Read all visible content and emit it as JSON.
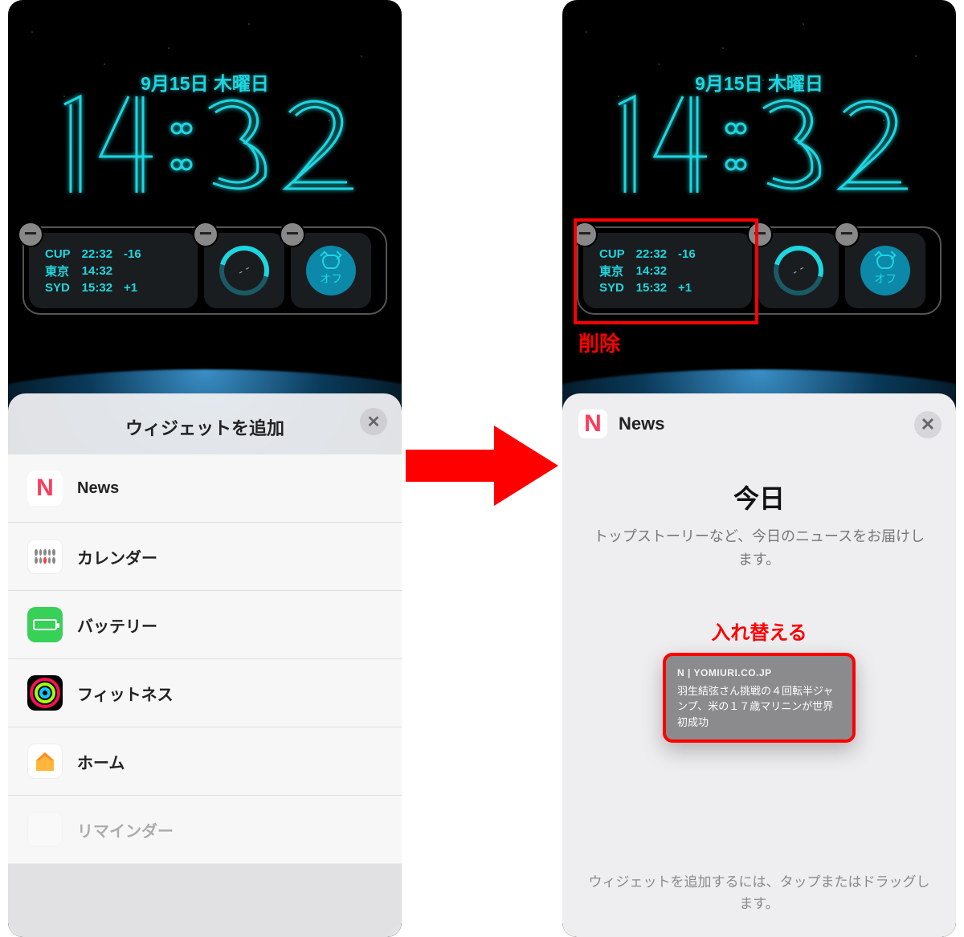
{
  "lockscreen": {
    "date": "9月15日 木曜日",
    "time": "14:32",
    "worldclock": [
      {
        "city": "CUP",
        "time": "22:32",
        "offset": "-16"
      },
      {
        "city": "東京",
        "time": "14:32",
        "offset": ""
      },
      {
        "city": "SYD",
        "time": "15:32",
        "offset": "+1"
      }
    ],
    "ring_value": "- -",
    "alarm_label": "オフ"
  },
  "annotations": {
    "delete_label": "削除",
    "replace_label": "入れ替える"
  },
  "gallery": {
    "title": "ウィジェットを追加",
    "items": [
      {
        "label": "News",
        "icon": "news"
      },
      {
        "label": "カレンダー",
        "icon": "calendar"
      },
      {
        "label": "バッテリー",
        "icon": "battery"
      },
      {
        "label": "フィットネス",
        "icon": "fitness"
      },
      {
        "label": "ホーム",
        "icon": "home"
      },
      {
        "label": "リマインダー",
        "icon": "reminders"
      }
    ]
  },
  "news_sheet": {
    "app_label": "News",
    "heading": "今日",
    "description": "トップストーリーなど、今日のニュースをお届けします。",
    "preview": {
      "source": "| YOMIURI.CO.JP",
      "headline": "羽生結弦さん挑戦の４回転半ジャンプ、米の１７歳マリニンが世界初成功"
    },
    "instruction": "ウィジェットを追加するには、タップまたはドラッグします。"
  }
}
